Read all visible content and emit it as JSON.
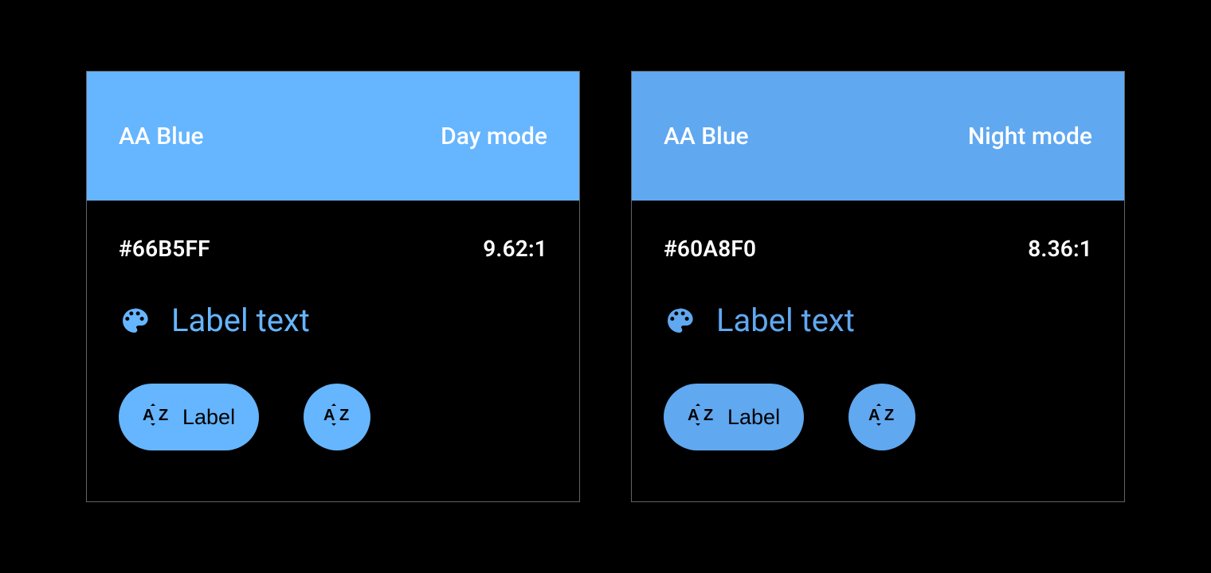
{
  "cards": [
    {
      "title": "AA Blue",
      "mode": "Day mode",
      "header_bg": "#66B5FF",
      "hex": "#66B5FF",
      "ratio": "9.62:1",
      "accent": "#66B5FF",
      "label_text": "Label text",
      "chip_label": "Label"
    },
    {
      "title": "AA Blue",
      "mode": "Night mode",
      "header_bg": "#60A8F0",
      "hex": "#60A8F0",
      "ratio": "8.36:1",
      "accent": "#60A8F0",
      "label_text": "Label text",
      "chip_label": "Label"
    }
  ]
}
